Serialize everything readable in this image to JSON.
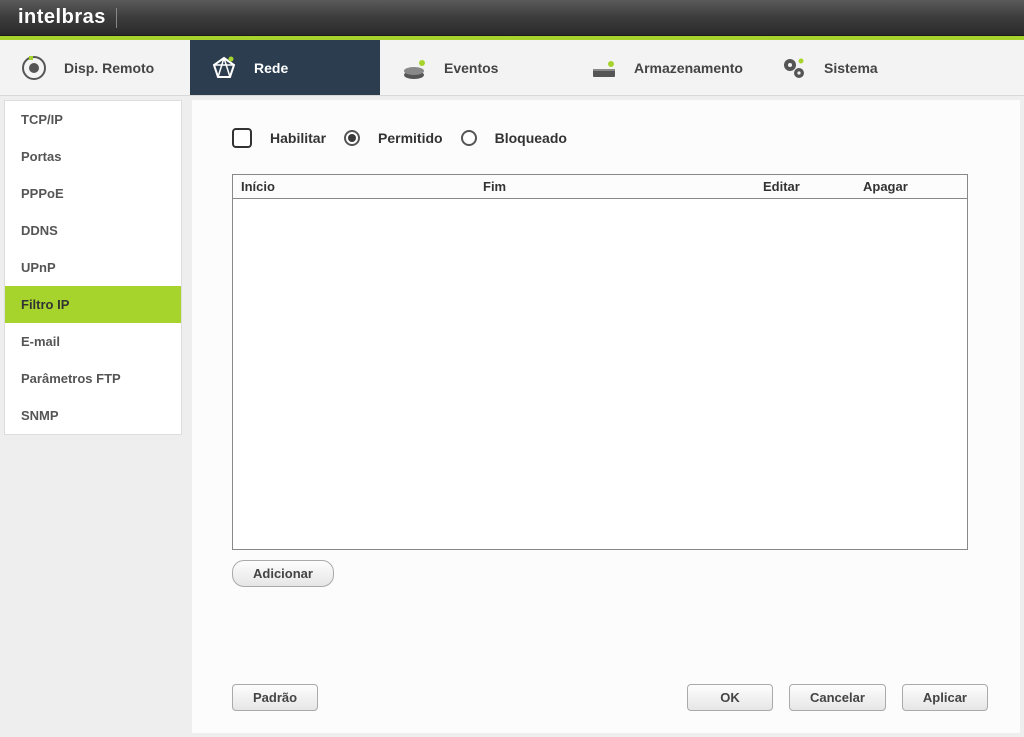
{
  "brand": "intelbras",
  "maintabs": [
    {
      "label": "Disp. Remoto"
    },
    {
      "label": "Rede"
    },
    {
      "label": "Eventos"
    },
    {
      "label": "Armazenamento"
    },
    {
      "label": "Sistema"
    }
  ],
  "sidebar": {
    "items": [
      {
        "label": "TCP/IP"
      },
      {
        "label": "Portas"
      },
      {
        "label": "PPPoE"
      },
      {
        "label": "DDNS"
      },
      {
        "label": "UPnP"
      },
      {
        "label": "Filtro IP"
      },
      {
        "label": "E-mail"
      },
      {
        "label": "Parâmetros FTP"
      },
      {
        "label": "SNMP"
      }
    ],
    "active_index": 5
  },
  "controls": {
    "enable_label": "Habilitar",
    "allowed_label": "Permitido",
    "blocked_label": "Bloqueado",
    "selected_mode": "allowed"
  },
  "table": {
    "columns": {
      "inicio": "Início",
      "fim": "Fim",
      "editar": "Editar",
      "apagar": "Apagar"
    },
    "rows": []
  },
  "buttons": {
    "add": "Adicionar",
    "default": "Padrão",
    "ok": "OK",
    "cancel": "Cancelar",
    "apply": "Aplicar"
  }
}
